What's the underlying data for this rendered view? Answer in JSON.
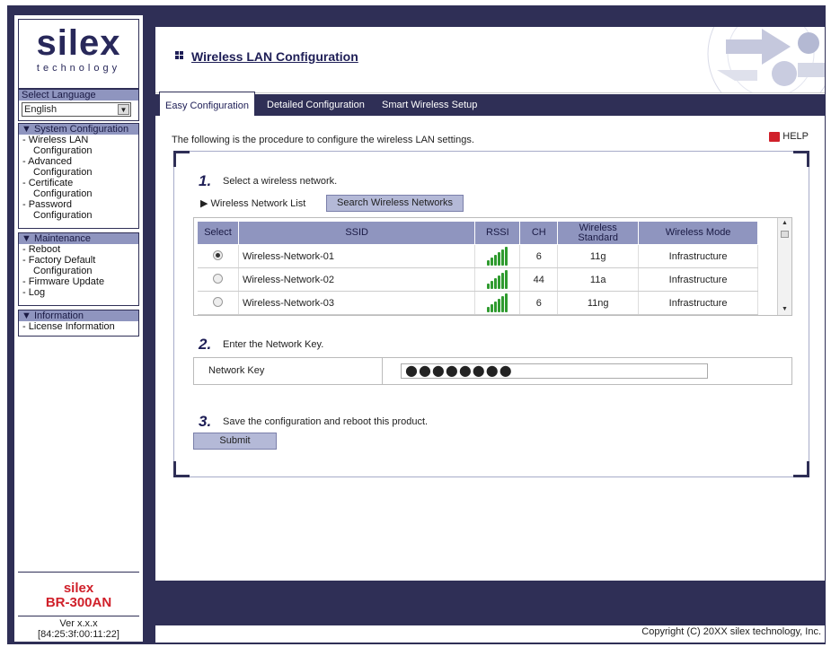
{
  "sidebar": {
    "logo_word": "silex",
    "logo_sub": "technology",
    "language_header": "Select Language",
    "language_value": "English",
    "sections": [
      {
        "header": "▼ System Configuration",
        "items": [
          "- Wireless LAN",
          "Configuration",
          "- Advanced",
          "Configuration",
          "- Certificate",
          "Configuration",
          "- Password",
          "Configuration"
        ]
      },
      {
        "header": "▼ Maintenance",
        "items": [
          "- Reboot",
          "- Factory Default",
          "Configuration",
          "- Firmware Update",
          "- Log"
        ]
      },
      {
        "header": "▼ Information",
        "items": [
          "- License Information"
        ]
      }
    ],
    "brand": "silex",
    "model": "BR-300AN",
    "version": "Ver x.x.x",
    "mac": "[84:25:3f:00:11:22]"
  },
  "main": {
    "title": "Wireless LAN Configuration",
    "tabs": [
      {
        "label": "Easy Configuration",
        "active": true
      },
      {
        "label": "Detailed Configuration",
        "active": false
      },
      {
        "label": "Smart Wireless Setup",
        "active": false
      }
    ],
    "intro": "The following is the procedure to configure the wireless LAN settings.",
    "help": "HELP",
    "step1": {
      "num": "1.",
      "text": "Select a wireless network."
    },
    "list_label": "▶ Wireless Network List",
    "search_button": "Search Wireless Networks",
    "table": {
      "headers": [
        "Select",
        "SSID",
        "RSSI",
        "CH",
        "Wireless Standard",
        "Wireless Mode"
      ],
      "rows": [
        {
          "selected": true,
          "ssid": "Wireless-Network-01",
          "ch": "6",
          "standard": "11g",
          "mode": "Infrastructure"
        },
        {
          "selected": false,
          "ssid": "Wireless-Network-02",
          "ch": "44",
          "standard": "11a",
          "mode": "Infrastructure"
        },
        {
          "selected": false,
          "ssid": "Wireless-Network-03",
          "ch": "6",
          "standard": "11ng",
          "mode": "Infrastructure"
        }
      ]
    },
    "step2": {
      "num": "2.",
      "text": "Enter the Network Key."
    },
    "key_label": "Network Key",
    "key_value": "●●●●●●●●",
    "step3": {
      "num": "3.",
      "text": "Save the configuration and reboot this product."
    },
    "submit_button": "Submit",
    "copyright": "Copyright (C) 20XX silex technology, Inc."
  }
}
